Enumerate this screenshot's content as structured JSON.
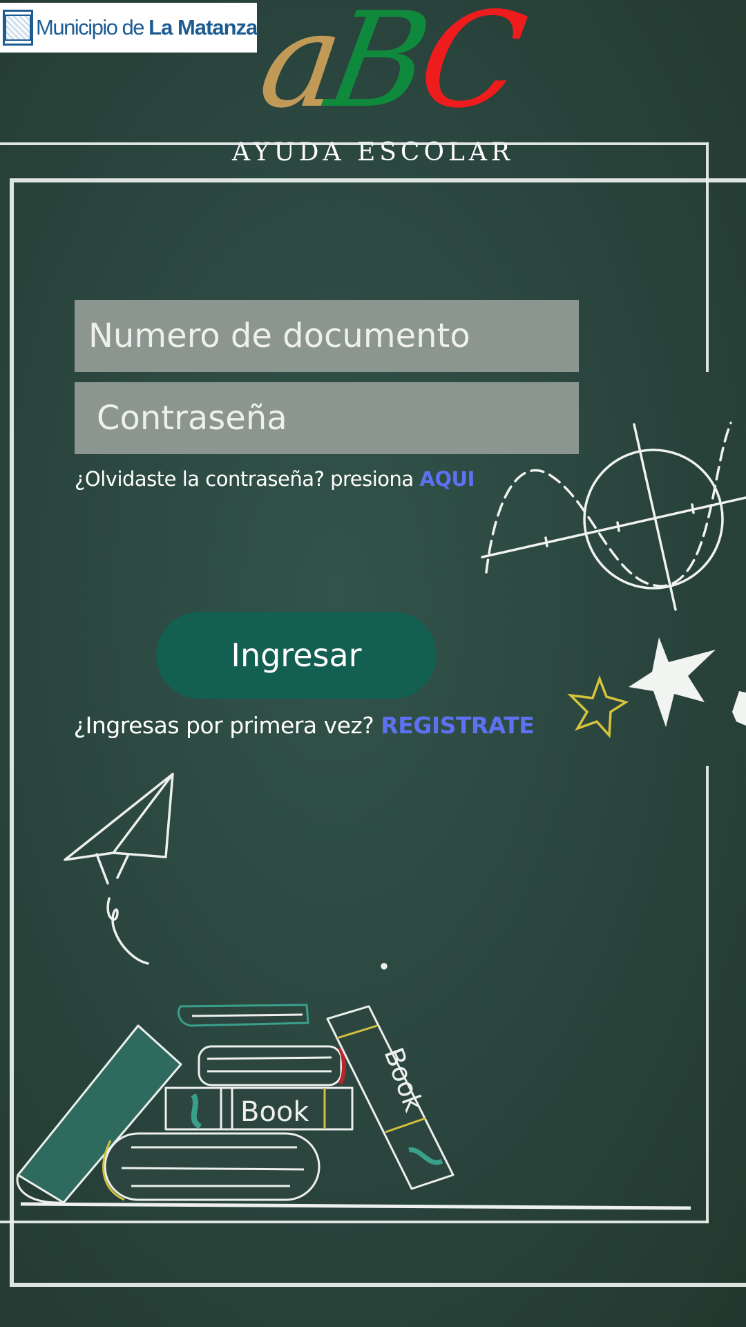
{
  "header": {
    "logo_text_light": "Municipio de ",
    "logo_text_bold": "La Matanza",
    "app_letters": [
      "a",
      "B",
      "C"
    ],
    "subtitle": "AYUDA ESCOLAR"
  },
  "form": {
    "document_placeholder": "Numero de documento",
    "password_placeholder": "Contraseña",
    "forgot_text": "¿Olvidaste la contraseña? presiona ",
    "forgot_link": "AQUI",
    "login_button": "Ingresar",
    "register_text": "¿Ingresas por primera vez? ",
    "register_link": "REGISTRATE"
  },
  "illustration": {
    "book_spine_label": "Book",
    "book_cover_label": "Book"
  },
  "colors": {
    "background": "#2b4740",
    "field": "#8a968f",
    "button": "#135f52",
    "link": "#5d72f0",
    "letter_a": "#c29a58",
    "letter_b": "#0f8a3d",
    "letter_c": "#ee1c1c"
  }
}
